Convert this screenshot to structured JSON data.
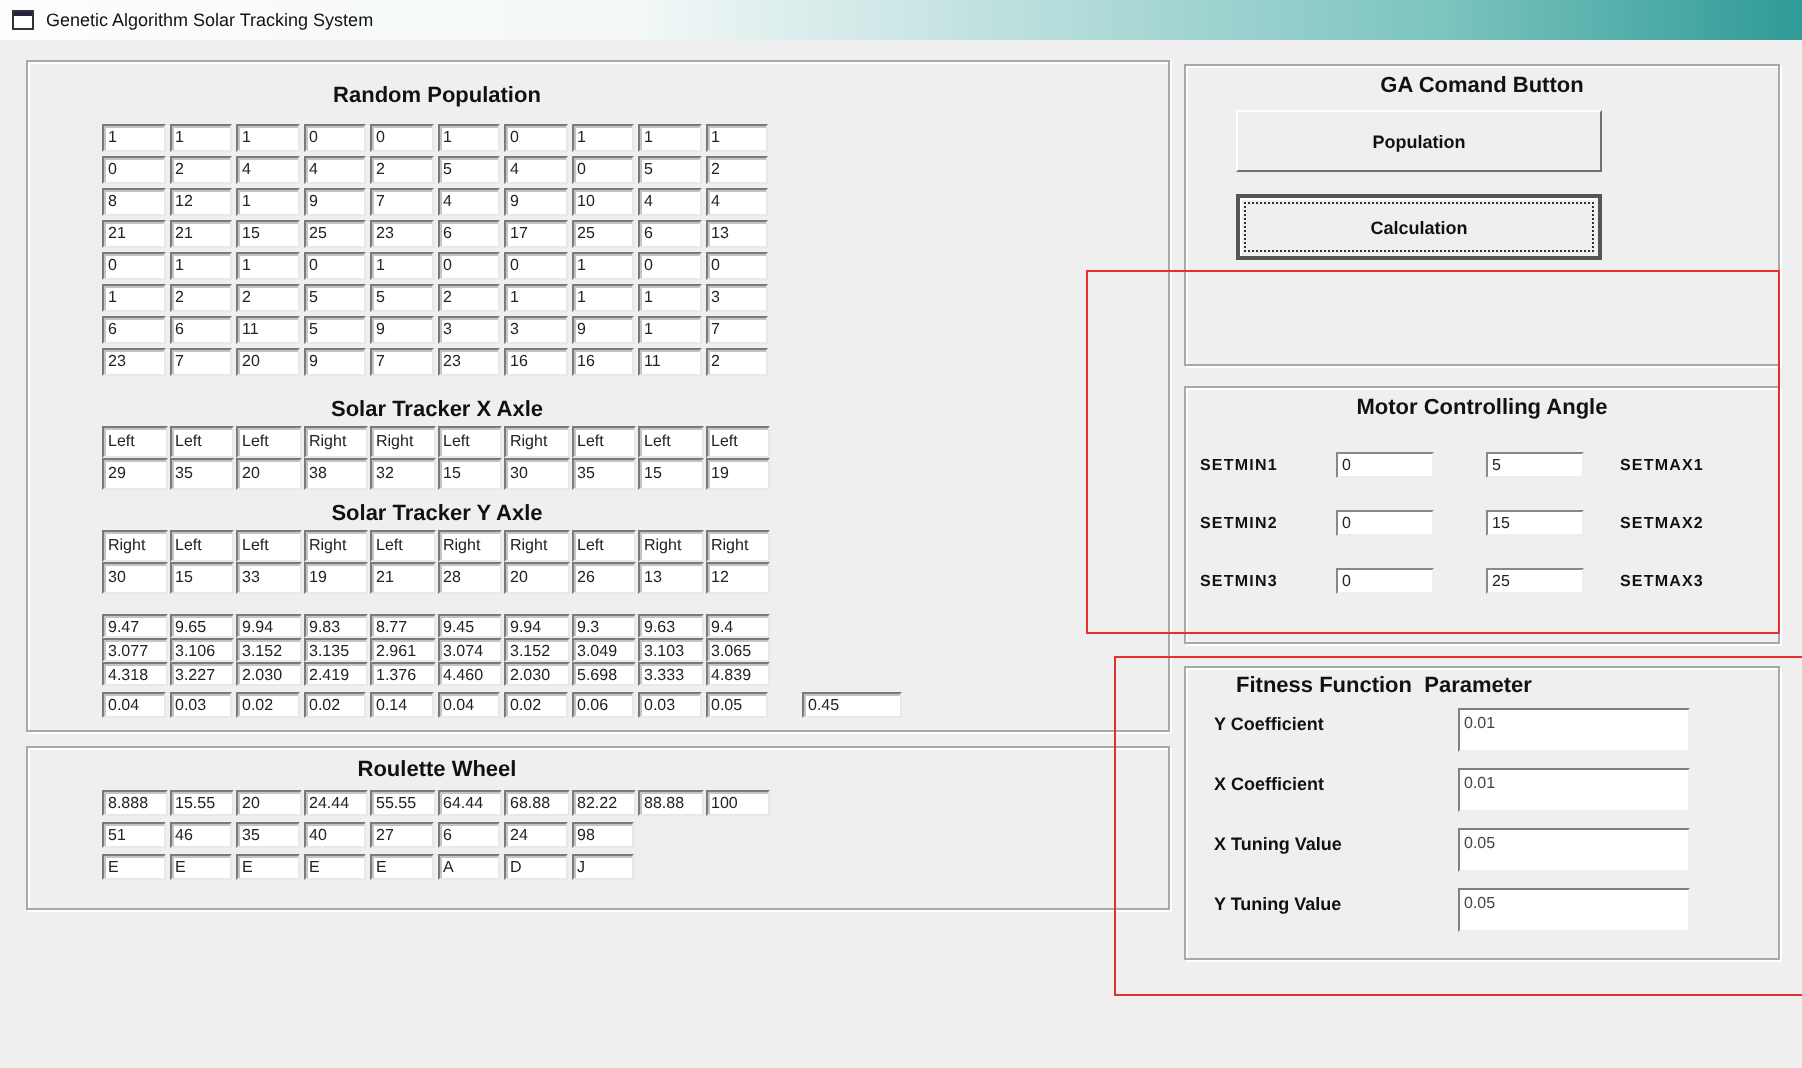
{
  "window": {
    "title": "Genetic Algorithm Solar Tracking System"
  },
  "random_population": {
    "title": "Random Population",
    "rows": [
      [
        "1",
        "1",
        "1",
        "0",
        "0",
        "1",
        "0",
        "1",
        "1",
        "1"
      ],
      [
        "0",
        "2",
        "4",
        "4",
        "2",
        "5",
        "4",
        "0",
        "5",
        "2"
      ],
      [
        "8",
        "12",
        "1",
        "9",
        "7",
        "4",
        "9",
        "10",
        "4",
        "4"
      ],
      [
        "21",
        "21",
        "15",
        "25",
        "23",
        "6",
        "17",
        "25",
        "6",
        "13"
      ],
      [
        "0",
        "1",
        "1",
        "0",
        "1",
        "0",
        "0",
        "1",
        "0",
        "0"
      ],
      [
        "1",
        "2",
        "2",
        "5",
        "5",
        "2",
        "1",
        "1",
        "1",
        "3"
      ],
      [
        "6",
        "6",
        "11",
        "5",
        "9",
        "3",
        "3",
        "9",
        "1",
        "7"
      ],
      [
        "23",
        "7",
        "20",
        "9",
        "7",
        "23",
        "16",
        "16",
        "11",
        "2"
      ]
    ]
  },
  "x_axle": {
    "title": "Solar Tracker X Axle",
    "directions": [
      "Left",
      "Left",
      "Left",
      "Right",
      "Right",
      "Left",
      "Right",
      "Left",
      "Left",
      "Left"
    ],
    "values": [
      "29",
      "35",
      "20",
      "38",
      "32",
      "15",
      "30",
      "35",
      "15",
      "19"
    ]
  },
  "y_axle": {
    "title": "Solar Tracker Y Axle",
    "directions": [
      "Right",
      "Left",
      "Left",
      "Right",
      "Left",
      "Right",
      "Right",
      "Left",
      "Right",
      "Right"
    ],
    "values": [
      "30",
      "15",
      "33",
      "19",
      "21",
      "28",
      "20",
      "26",
      "13",
      "12"
    ]
  },
  "calculation_rows": [
    [
      "9.47",
      "9.65",
      "9.94",
      "9.83",
      "8.77",
      "9.45",
      "9.94",
      "9.3",
      "9.63",
      "9.4"
    ],
    [
      "3.077",
      "3.106",
      "3.152",
      "3.135",
      "2.961",
      "3.074",
      "3.152",
      "3.049",
      "3.103",
      "3.065"
    ],
    [
      "4.318",
      "3.227",
      "2.030",
      "2.419",
      "1.376",
      "4.460",
      "2.030",
      "5.698",
      "3.333",
      "4.839"
    ]
  ],
  "fitness_row": {
    "values": [
      "0.04",
      "0.03",
      "0.02",
      "0.02",
      "0.14",
      "0.04",
      "0.02",
      "0.06",
      "0.03",
      "0.05"
    ],
    "total": "0.45"
  },
  "roulette_wheel": {
    "title": "Roulette Wheel",
    "rows": [
      [
        "8.888",
        "15.55",
        "20",
        "24.44",
        "55.55",
        "64.44",
        "68.88",
        "82.22",
        "88.88",
        "100"
      ],
      [
        "51",
        "46",
        "35",
        "40",
        "27",
        "6",
        "24",
        "98"
      ],
      [
        "E",
        "E",
        "E",
        "E",
        "E",
        "A",
        "D",
        "J"
      ]
    ]
  },
  "ga_command": {
    "title": "GA Comand Button",
    "buttons": [
      {
        "label": "Population",
        "focused": false
      },
      {
        "label": "Calculation",
        "focused": true
      }
    ]
  },
  "motor_angle": {
    "title": "Motor Controlling Angle",
    "rows": [
      {
        "min_label": "SETMIN1",
        "min_value": "0",
        "max_value": "5",
        "max_label": "SETMAX1"
      },
      {
        "min_label": "SETMIN2",
        "min_value": "0",
        "max_value": "15",
        "max_label": "SETMAX2"
      },
      {
        "min_label": "SETMIN3",
        "min_value": "0",
        "max_value": "25",
        "max_label": "SETMAX3"
      }
    ]
  },
  "fitness_parameters": {
    "title": "Fitness Function  Parameter",
    "fields": [
      {
        "label": "Y Coefficient",
        "value": "0.01"
      },
      {
        "label": "X Coefficient",
        "value": "0.01"
      },
      {
        "label": "X Tuning Value",
        "value": "0.05"
      },
      {
        "label": "Y Tuning Value",
        "value": "0.05"
      }
    ]
  }
}
